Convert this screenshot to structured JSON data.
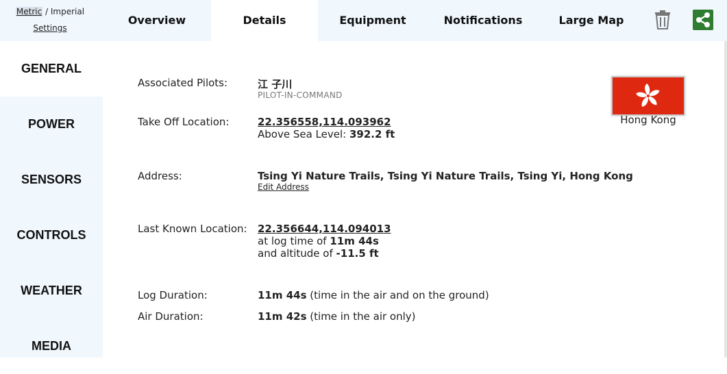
{
  "units": {
    "metric_label": "Metric",
    "separator": " / ",
    "imperial_label": "Imperial",
    "settings_label": "Settings"
  },
  "tabs": [
    {
      "label": "Overview"
    },
    {
      "label": "Details"
    },
    {
      "label": "Equipment"
    },
    {
      "label": "Notifications"
    },
    {
      "label": "Large Map"
    }
  ],
  "active_tab": "Details",
  "icons": {
    "trash": "trash-icon",
    "share": "share-icon"
  },
  "colors": {
    "nav_bg": "#f0f7fd",
    "share_green": "#2e7d32",
    "flag_red": "#de2910"
  },
  "sidebar": {
    "items": [
      {
        "label": "GENERAL"
      },
      {
        "label": "POWER"
      },
      {
        "label": "SENSORS"
      },
      {
        "label": "CONTROLS"
      },
      {
        "label": "WEATHER"
      },
      {
        "label": "MEDIA"
      }
    ],
    "active": "GENERAL"
  },
  "details": {
    "pilots_label": "Associated Pilots:",
    "pilot_name": "江 子川",
    "pilot_role": "PILOT-IN-COMMAND",
    "takeoff_label": "Take Off Location:",
    "takeoff_coords": "22.356558,114.093962",
    "asl_prefix": "Above Sea Level: ",
    "asl_value": "392.2 ft",
    "address_label": "Address:",
    "address_value": "Tsing Yi Nature Trails, Tsing Yi Nature Trails, Tsing Yi, Hong Kong",
    "edit_address": "Edit Address",
    "last_label": "Last Known Location:",
    "last_coords": "22.356644,114.094013",
    "log_time_prefix": "at log time of ",
    "log_time_value": "11m 44s",
    "altitude_prefix": "and altitude of ",
    "altitude_value": "-11.5 ft",
    "log_duration_label": "Log Duration:",
    "log_duration_value": "11m 44s",
    "log_duration_note": " (time in the air and on the ground)",
    "air_duration_label": "Air Duration:",
    "air_duration_value": "11m 42s",
    "air_duration_note": " (time in the air only)"
  },
  "flag": {
    "caption": "Hong Kong"
  }
}
